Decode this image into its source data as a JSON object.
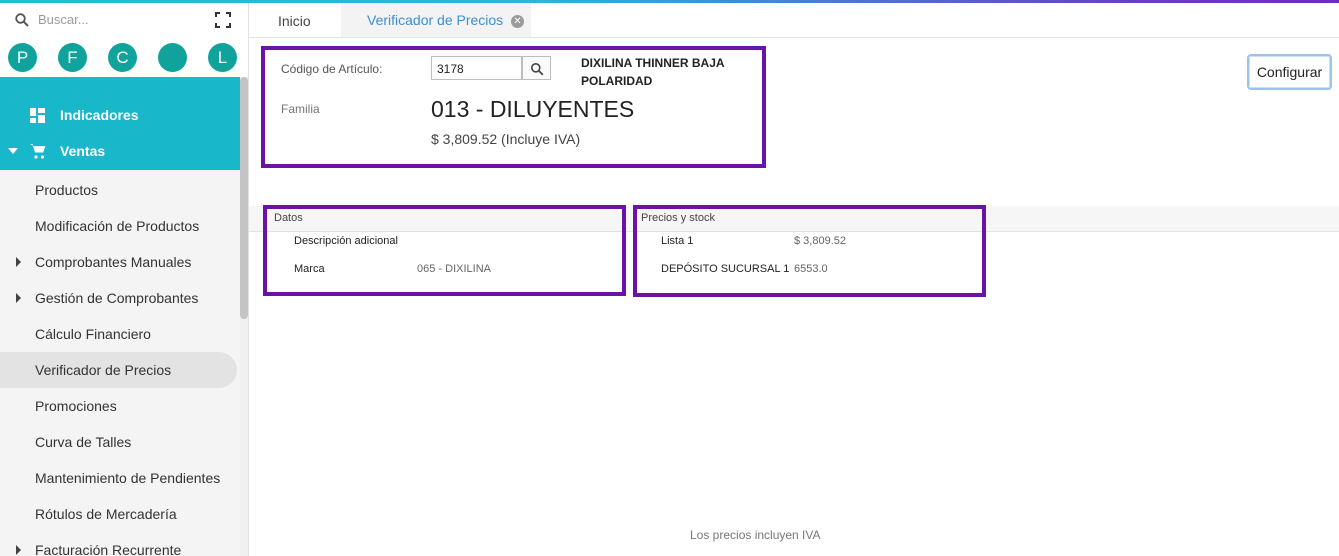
{
  "search": {
    "placeholder": "Buscar..."
  },
  "avatars": [
    "P",
    "F",
    "C",
    "",
    "L"
  ],
  "menu": {
    "indicadores": "Indicadores",
    "ventas": "Ventas",
    "submenu": [
      {
        "label": "Productos",
        "expandable": false,
        "active": false
      },
      {
        "label": "Modificación de Productos",
        "expandable": false,
        "active": false
      },
      {
        "label": "Comprobantes Manuales",
        "expandable": true,
        "active": false
      },
      {
        "label": "Gestión de Comprobantes",
        "expandable": true,
        "active": false
      },
      {
        "label": "Cálculo Financiero",
        "expandable": false,
        "active": false
      },
      {
        "label": "Verificador de Precios",
        "expandable": false,
        "active": true
      },
      {
        "label": "Promociones",
        "expandable": false,
        "active": false
      },
      {
        "label": "Curva de Talles",
        "expandable": false,
        "active": false
      },
      {
        "label": "Mantenimiento de Pendientes",
        "expandable": false,
        "active": false
      },
      {
        "label": "Rótulos de Mercadería",
        "expandable": false,
        "active": false
      },
      {
        "label": "Facturación Recurrente",
        "expandable": true,
        "active": false
      }
    ]
  },
  "tabs": {
    "home": "Inicio",
    "active": "Verificador de Precios"
  },
  "article": {
    "code_label": "Código de Artículo:",
    "code_value": "3178",
    "description": "DIXILINA THINNER BAJA POLARIDAD",
    "family_label": "Familia",
    "family_value": "013 - DILUYENTES",
    "price": "$ 3,809.52 (Incluye IVA)"
  },
  "configure_button": "Configurar",
  "datos": {
    "title": "Datos",
    "rows": [
      {
        "label": "Descripción adicional",
        "value": ""
      },
      {
        "label": "Marca",
        "value": "065 - DIXILINA"
      }
    ]
  },
  "stock": {
    "title": "Precios y stock",
    "rows": [
      {
        "label": "Lista 1",
        "value": "$ 3,809.52"
      },
      {
        "label": "DEPÓSITO SUCURSAL 1",
        "value": "6553.0"
      }
    ]
  },
  "footer_note": "Los precios incluyen IVA",
  "colors": {
    "accent": "#18b7c9",
    "highlight_border": "#6a13a6",
    "avatar": "#0fa39c",
    "tab_active_text": "#3a8fd6"
  }
}
